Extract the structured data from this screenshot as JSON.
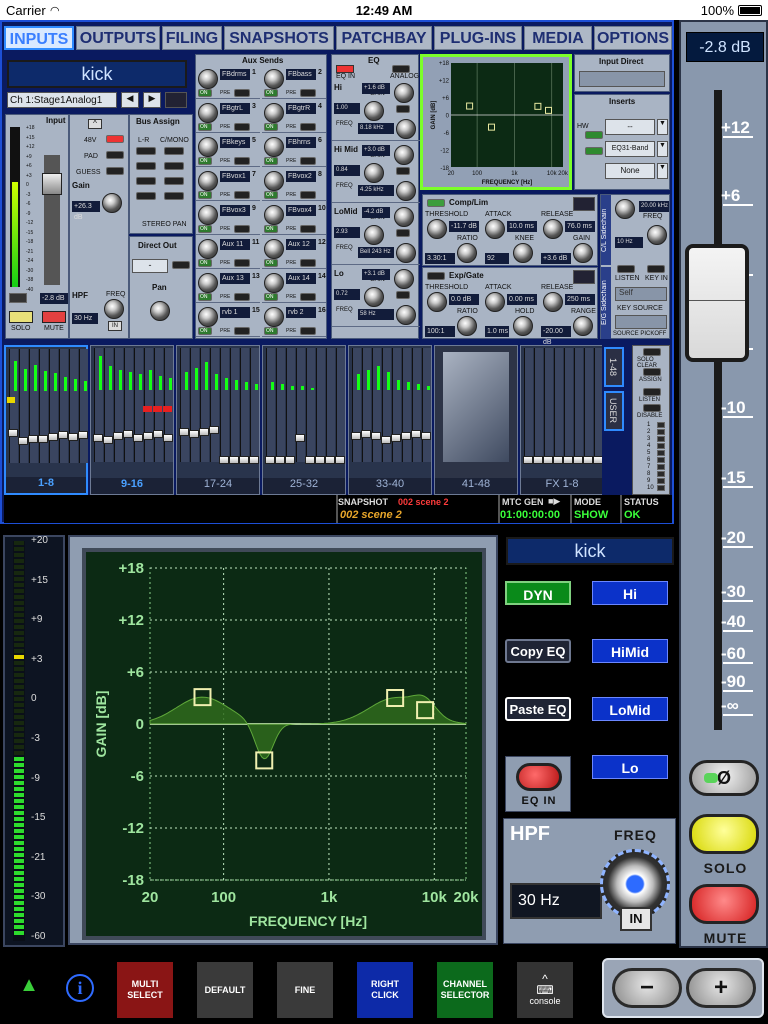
{
  "status": {
    "carrier": "Carrier",
    "time": "12:49 AM",
    "battery": "100%"
  },
  "tabs": [
    "INPUTS",
    "OUTPUTS",
    "FILING",
    "SNAPSHOTS",
    "PATCHBAY",
    "PLUG-INS",
    "MEDIA",
    "OPTIONS"
  ],
  "channel": {
    "name": "kick",
    "selector": "Ch 1:Stage1Analog1"
  },
  "input": {
    "title": "Input",
    "v48": "48V",
    "pad": "PAD",
    "guess": "GUESS",
    "gain": "Gain",
    "gain_val": "+26.3 dB",
    "meter_val": "-2.8 dB",
    "hpf": "HPF",
    "hpf_freq": "FREQ",
    "hpf_val": "30 Hz",
    "in": "IN",
    "solo": "SOLO",
    "mute": "MUTE",
    "scale": [
      "+18",
      "+15",
      "+12",
      "+9",
      "+6",
      "+3",
      "0",
      "-3",
      "-6",
      "-9",
      "-12",
      "-15",
      "-18",
      "-21",
      "-24",
      "-30",
      "-38",
      "-40"
    ]
  },
  "bus": {
    "title": "Bus Assign",
    "lr": "L-R",
    "cmono": "C/MONO",
    "stereo_pan": "STEREO PAN",
    "direct_out": "Direct Out",
    "pan": "Pan"
  },
  "aux": {
    "title": "Aux Sends",
    "on": "ON",
    "pre": "PRE",
    "sends": [
      "FBdrms",
      "FBbass",
      "FBgtrL",
      "FBgtrR",
      "FBkeys",
      "FBhrns",
      "FBvox1",
      "FBvox2",
      "FBvox3",
      "FBvox4",
      "Aux 11",
      "Aux 12",
      "Aux 13",
      "Aux 14",
      "rvb 1",
      "rvb 2"
    ],
    "nums": [
      "1",
      "2",
      "3",
      "4",
      "5",
      "6",
      "7",
      "8",
      "9",
      "10",
      "11",
      "12",
      "13",
      "14",
      "15",
      "16"
    ]
  },
  "eqmini": {
    "title": "EQ",
    "eqin": "EQ IN",
    "analog": "ANALOG",
    "bands": [
      {
        "name": "Hi",
        "gain": "+1.6 dB",
        "q": "1.00",
        "freq": "8.18 kHz"
      },
      {
        "name": "Hi Mid",
        "gain": "+3.0 dB",
        "q": "0.84",
        "freq": "4.25 kHz"
      },
      {
        "name": "LoMid",
        "gain": "-4.2 dB",
        "q": "2.93",
        "freq": "Bell 243 Hz"
      },
      {
        "name": "Lo",
        "gain": "+3.1 dB",
        "q": "0.72",
        "freq": "58 Hz"
      }
    ],
    "gain": "GAIN",
    "freq": "FREQ",
    "in": "IN"
  },
  "eqplot_small": {
    "ylabel": "GAIN [dB]",
    "xlabel": "FREQUENCY [Hz]",
    "yticks": [
      "+18",
      "+12",
      "+6",
      "0",
      "-6",
      "-12",
      "-18"
    ],
    "xticks": [
      "20",
      "100",
      "1k",
      "10k",
      "20k"
    ]
  },
  "inputdirect": {
    "title": "Input Direct"
  },
  "inserts": {
    "title": "Inserts",
    "hw": "HW",
    "slot1": "--",
    "slot2": "EQ31-Band",
    "slot3": "None",
    "in": "IN"
  },
  "comp": {
    "title": "Comp/Lim",
    "threshold": "THRESHOLD",
    "attack": "ATTACK",
    "release": "RELEASE",
    "ratio": "RATIO",
    "knee": "KNEE",
    "gain": "GAIN",
    "threshold_val": "-11.7 dB",
    "attack_val": "10.0 ms",
    "release_val": "76.0 ms",
    "ratio_val": "3.30:1",
    "knee_val": "92",
    "gain_val": "+3.6 dB"
  },
  "gate": {
    "title": "Exp/Gate",
    "threshold": "THRESHOLD",
    "attack": "ATTACK",
    "release": "RELEASE",
    "ratio": "RATIO",
    "hold": "HOLD",
    "range": "RANGE",
    "threshold_val": "0.0 dB",
    "attack_val": "0.00 ms",
    "release_val": "250 ms",
    "ratio_val": "100:1",
    "hold_val": "1.0 ms",
    "range_val": "-20.00 dB"
  },
  "sidechain": {
    "cl": "C/L Sidechain",
    "eg": "E/G Sidechain",
    "freq": "FREQ",
    "freq_val": "20.00 kHz",
    "freq_val2": "10 Hz",
    "listen": "LISTEN",
    "keyin": "KEY IN",
    "self": "Self",
    "keysrc": "KEY SOURCE",
    "srcpick": "SOURCE PICKOFF"
  },
  "banks": [
    "1-8",
    "9-16",
    "17-24",
    "25-32",
    "33-40",
    "41-48",
    "FX 1-8"
  ],
  "bankselect": [
    "1-48",
    "USER"
  ],
  "soloclear": {
    "solo_clear": "SOLO CLEAR",
    "assign": "ASSIGN",
    "listen": "LISTEN",
    "disable": "DISABLE",
    "nums": [
      "1",
      "2",
      "3",
      "4",
      "5",
      "6",
      "7",
      "8",
      "9",
      "10"
    ]
  },
  "snapshot": {
    "label": "SNAPSHOT",
    "num": "002 scene 2",
    "current": "002 scene 2",
    "mtc_label": "MTC GEN",
    "mtc": "01:00:00:00",
    "mode_label": "MODE",
    "mode": "SHOW",
    "status_label": "STATUS",
    "status": "OK"
  },
  "fader": {
    "value": "-2.8 dB",
    "scale": [
      "+12",
      "+6",
      "0",
      "-5",
      "-10",
      "-15",
      "-20",
      "-30",
      "-40",
      "-60",
      "-90",
      "-∞"
    ],
    "invert": "Ø",
    "solo": "SOLO",
    "mute": "MUTE"
  },
  "meter": {
    "scale": [
      "+20",
      "+15",
      "+9",
      "+3",
      "0",
      "-3",
      "-9",
      "-15",
      "-21",
      "-30",
      "-60"
    ]
  },
  "eq": {
    "ylabel": "GAIN [dB]",
    "xlabel": "FREQUENCY [Hz]",
    "yticks": [
      "+18",
      "+12",
      "+6",
      "0",
      "-6",
      "-12",
      "-18"
    ],
    "xticks": [
      "20",
      "100",
      "1k",
      "10k",
      "20k"
    ],
    "nodes": [
      {
        "f": 63,
        "g": 3.1
      },
      {
        "f": 243,
        "g": -4.2
      },
      {
        "f": 4250,
        "g": 3.0
      },
      {
        "f": 8180,
        "g": 1.6
      }
    ]
  },
  "eqside": {
    "name": "kick",
    "dyn": "DYN",
    "copy": "Copy EQ",
    "paste": "Paste EQ",
    "eqin": "EQ IN",
    "bands": [
      "Hi",
      "HiMid",
      "LoMid",
      "Lo"
    ]
  },
  "hpf": {
    "title": "HPF",
    "freq": "FREQ",
    "value": "30 Hz",
    "in": "IN"
  },
  "toolbar": {
    "multi": "MULTI SELECT",
    "default": "DEFAULT",
    "fine": "FINE",
    "right": "RIGHT CLICK",
    "channel": "CHANNEL SELECTOR",
    "console": "console",
    "minus": "−",
    "plus": "+"
  }
}
